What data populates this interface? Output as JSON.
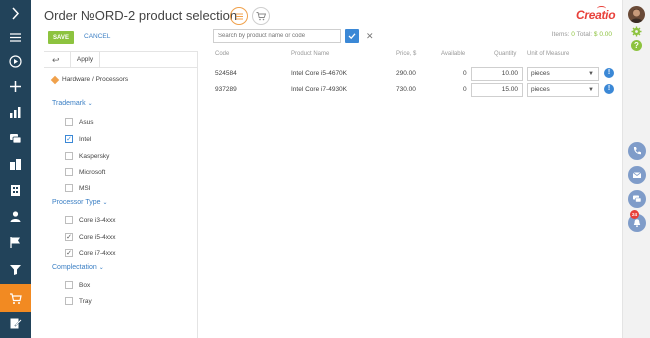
{
  "page": {
    "title": "Order №ORD-2 product selection",
    "logo": "Creatio"
  },
  "toolbar": {
    "save_label": "SAVE",
    "cancel_label": "CANCEL",
    "search_placeholder": "Search by product name or code",
    "items_label": "Items:",
    "items_count": "0",
    "total_label": "Total:",
    "total_value": "$ 0.00"
  },
  "filter": {
    "apply_label": "Apply",
    "breadcrumb": "Hardware / Processors",
    "groups": [
      {
        "title": "Trademark",
        "options": [
          {
            "label": "Asus",
            "checked": false
          },
          {
            "label": "Intel",
            "checked": true
          },
          {
            "label": "Kaspersky",
            "checked": false
          },
          {
            "label": "Microsoft",
            "checked": false
          },
          {
            "label": "MSI",
            "checked": false
          }
        ]
      },
      {
        "title": "Processor Type",
        "options": [
          {
            "label": "Core i3-4xxx",
            "checked": false
          },
          {
            "label": "Core i5-4xxx",
            "checked": true
          },
          {
            "label": "Core i7-4xxx",
            "checked": true
          }
        ]
      },
      {
        "title": "Complectation",
        "options": [
          {
            "label": "Box",
            "checked": false
          },
          {
            "label": "Tray",
            "checked": false
          }
        ]
      }
    ]
  },
  "table": {
    "columns": [
      "Code",
      "Product Name",
      "Price, $",
      "Available",
      "Quantity",
      "Unit of Measure"
    ],
    "rows": [
      {
        "code": "524584",
        "name": "Intel Core i5-4670K",
        "price": "290.00",
        "available": "0",
        "quantity": "10.00",
        "unit": "pieces"
      },
      {
        "code": "937289",
        "name": "Intel Core i7-4930K",
        "price": "730.00",
        "available": "0",
        "quantity": "15.00",
        "unit": "pieces"
      }
    ]
  },
  "notifications": {
    "badge": "24"
  },
  "colors": {
    "sidebar": "#22435a",
    "accent_orange": "#f28a22",
    "save_green": "#8dc33f",
    "link_blue": "#3b7fc4",
    "rail_blue": "#7f9cc9",
    "brand_red": "#e8403a"
  },
  "icons": {
    "left_sidebar": [
      "expand-icon",
      "menu-icon",
      "play-icon",
      "add-icon",
      "chart-icon",
      "feed-icon",
      "buildings-icon",
      "building-icon",
      "contact-icon",
      "flag-icon",
      "funnel-icon",
      "cart-icon",
      "edit-document-icon"
    ],
    "right_rail": [
      "avatar",
      "gear-icon",
      "help-icon",
      "phone-icon",
      "email-icon",
      "chat-icon",
      "bell-icon"
    ]
  }
}
